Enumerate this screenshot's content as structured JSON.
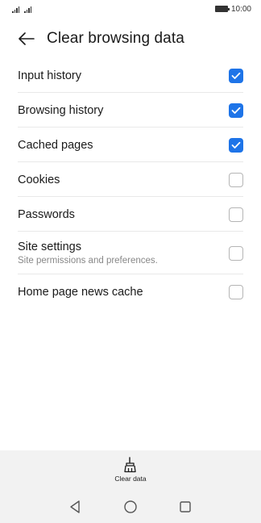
{
  "status_bar": {
    "time": "10:00"
  },
  "header": {
    "title": "Clear browsing data"
  },
  "options": [
    {
      "label": "Input history",
      "sub": "",
      "checked": true
    },
    {
      "label": "Browsing history",
      "sub": "",
      "checked": true
    },
    {
      "label": "Cached pages",
      "sub": "",
      "checked": true
    },
    {
      "label": "Cookies",
      "sub": "",
      "checked": false
    },
    {
      "label": "Passwords",
      "sub": "",
      "checked": false
    },
    {
      "label": "Site settings",
      "sub": "Site permissions and preferences.",
      "checked": false
    },
    {
      "label": "Home page news cache",
      "sub": "",
      "checked": false
    }
  ],
  "bottom_bar": {
    "clear_data_label": "Clear data"
  },
  "colors": {
    "accent": "#1e74e8"
  }
}
